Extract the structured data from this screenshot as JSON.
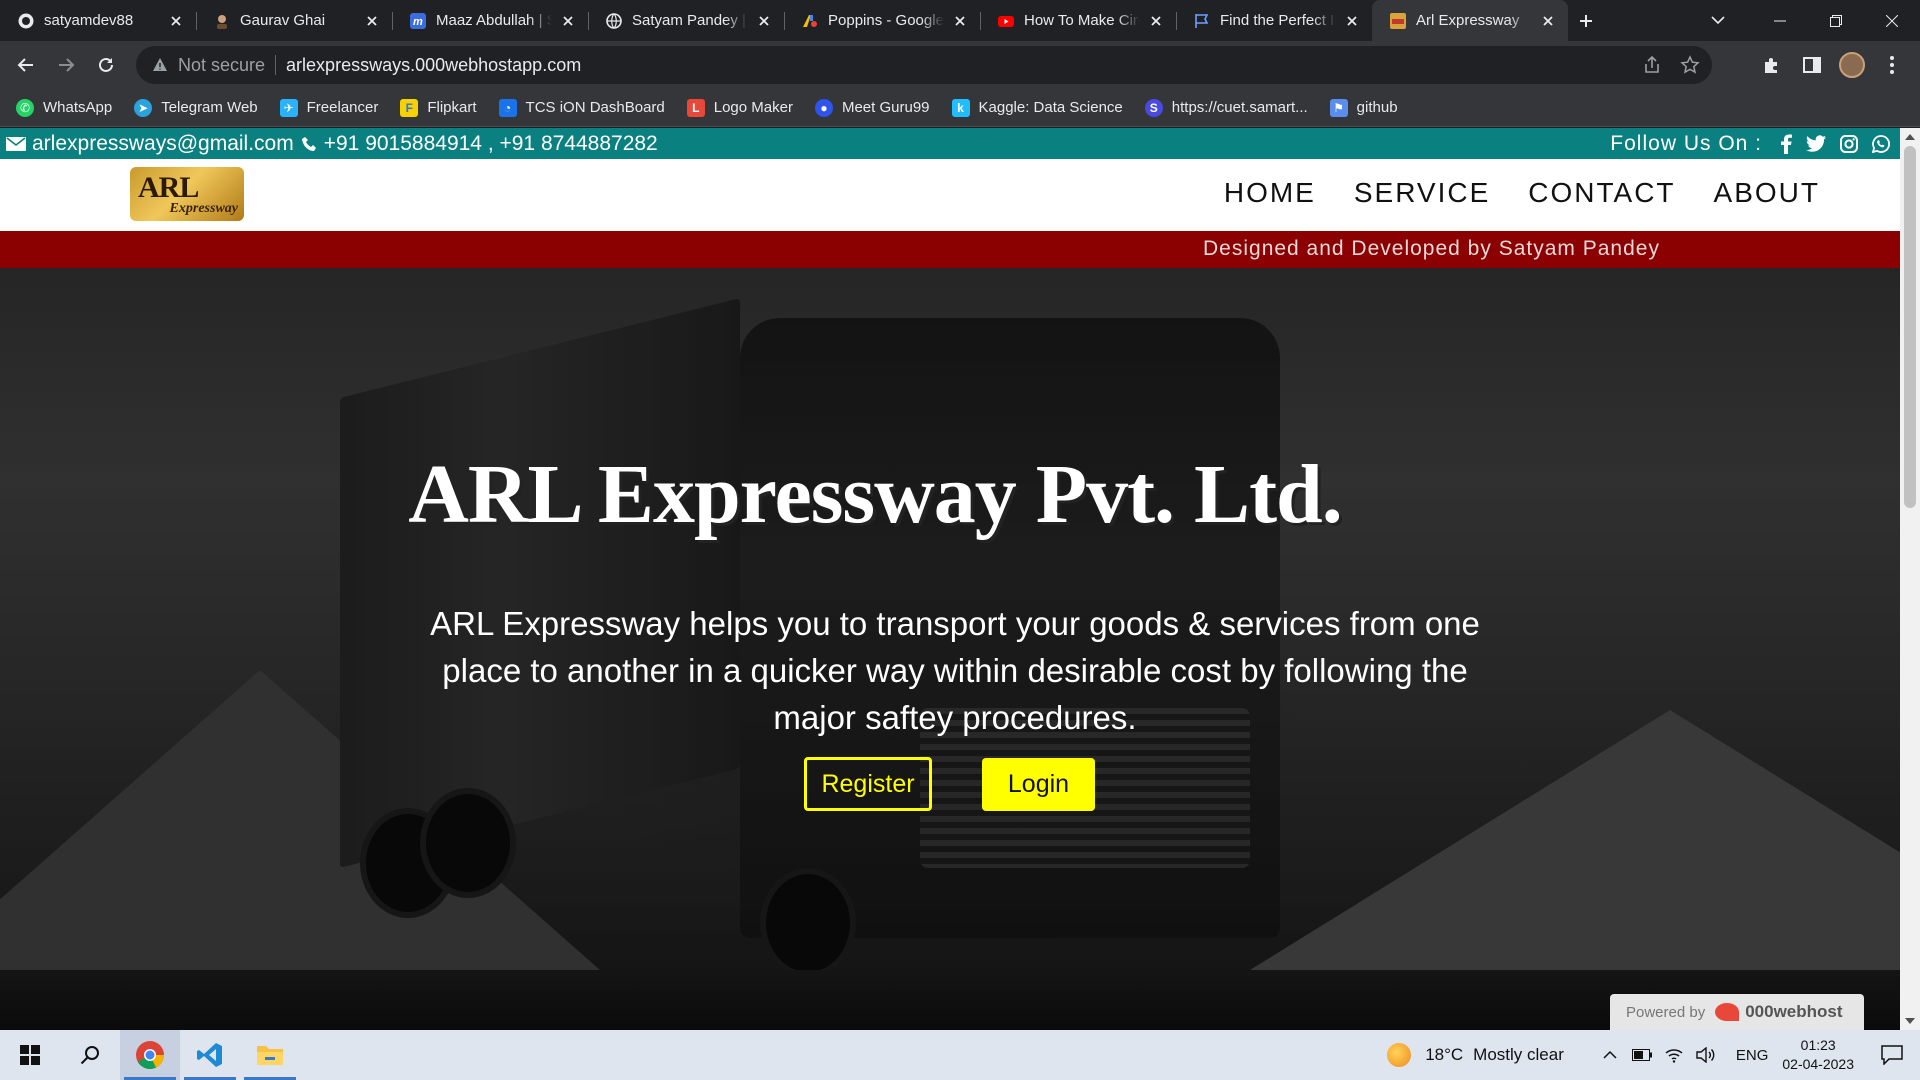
{
  "browser": {
    "tabs": [
      {
        "title": "satyamdev88",
        "icon": "github-icon",
        "active": false
      },
      {
        "title": "Gaurav Ghai",
        "icon": "avatar-icon",
        "active": false
      },
      {
        "title": "Maaz Abdullah | S",
        "icon": "m-logo-icon",
        "active": false
      },
      {
        "title": "Satyam Pandey | V",
        "icon": "globe-icon",
        "active": false
      },
      {
        "title": "Poppins - Google",
        "icon": "google-fonts-icon",
        "active": false
      },
      {
        "title": "How To Make Circ",
        "icon": "youtube-icon",
        "active": false
      },
      {
        "title": "Find the Perfect Ic",
        "icon": "flag-icon",
        "active": false
      },
      {
        "title": "Arl Expressway",
        "icon": "site-icon",
        "active": true
      }
    ],
    "security_label": "Not secure",
    "url": "arlexpressways.000webhostapp.com",
    "bookmarks": [
      {
        "label": "WhatsApp",
        "icon": "whatsapp-icon",
        "color": "#25d366"
      },
      {
        "label": "Telegram Web",
        "icon": "telegram-icon",
        "color": "#2aa3df"
      },
      {
        "label": "Freelancer",
        "icon": "freelancer-icon",
        "color": "#29b2fe"
      },
      {
        "label": "Flipkart",
        "icon": "flipkart-icon",
        "color": "#f7d200"
      },
      {
        "label": "TCS iON DashBoard",
        "icon": "tcs-icon",
        "color": "#1a73e8"
      },
      {
        "label": "Logo Maker",
        "icon": "logo-maker-icon",
        "color": "#e8483a"
      },
      {
        "label": "Meet Guru99",
        "icon": "guru99-icon",
        "color": "#2f54eb"
      },
      {
        "label": "Kaggle: Data Science",
        "icon": "kaggle-icon",
        "color": "#20beff"
      },
      {
        "label": "https://cuet.samart...",
        "icon": "s-icon",
        "color": "#4a4adf"
      },
      {
        "label": "github",
        "icon": "flag-icon",
        "color": "#5b8def"
      }
    ]
  },
  "site": {
    "email": "arlexpressways@gmail.com",
    "phones": "+91 9015884914 , +91 8744887282",
    "follow_label": "Follow Us On :",
    "logo_main": "ARL",
    "logo_sub": "Expressway",
    "nav": [
      "HOME",
      "SERVICE",
      "CONTACT",
      "ABOUT"
    ],
    "credit": "Designed and Developed by Satyam Pandey",
    "hero_title": "ARL Expressway Pvt. Ltd.",
    "hero_desc": "ARL Expressway helps you to transport your goods & services from one place to another in a quicker way within desirable cost by following the major saftey procedures.",
    "register_label": "Register",
    "login_label": "Login",
    "powered_by": "Powered by",
    "powered_brand": "000webhost",
    "colors": {
      "topbar": "#0b8080",
      "credit_bar": "#8b0000",
      "accent": "#ffff00"
    }
  },
  "taskbar": {
    "temperature": "18°C",
    "weather": "Mostly clear",
    "language": "ENG",
    "time": "01:23",
    "date": "02-04-2023"
  }
}
